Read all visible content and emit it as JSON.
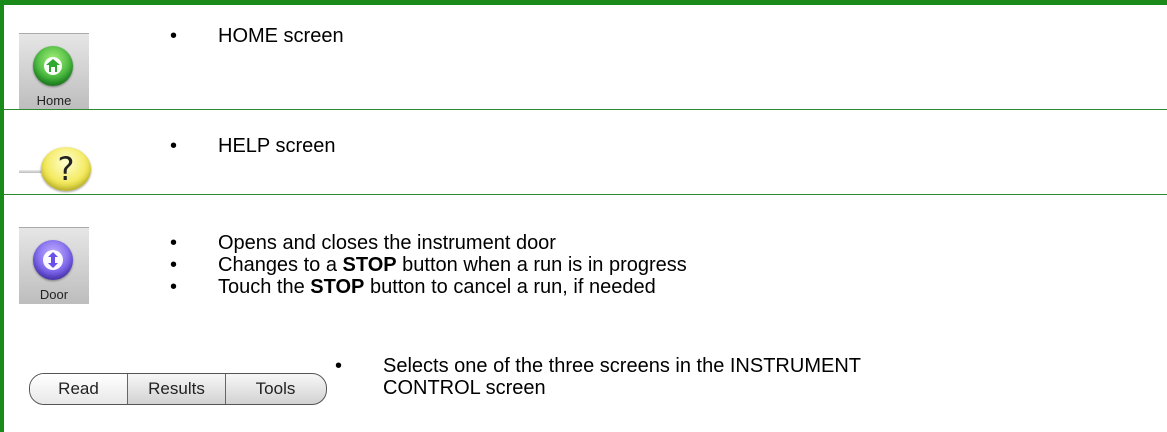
{
  "rows": [
    {
      "icon": {
        "name": "home",
        "label": "Home"
      },
      "bullets": [
        "HOME screen"
      ]
    },
    {
      "icon": {
        "name": "help",
        "glyph": "?"
      },
      "bullets": [
        "HELP screen"
      ]
    },
    {
      "icon": {
        "name": "door",
        "label": "Door"
      },
      "bullets": [
        "Opens and closes the instrument door",
        "Changes to a STOP button when a run is in progress",
        "Touch the STOP button to cancel a run, if needed"
      ],
      "bullets_parts": [
        {
          "pre": "Changes to a ",
          "bold": "STOP",
          "post": " button when a run is in progress"
        },
        {
          "pre": "Touch the ",
          "bold": "STOP",
          "post": " button to cancel a run, if needed"
        }
      ]
    },
    {
      "segmented": {
        "labels": [
          "Read",
          "Results",
          "Tools"
        ],
        "active_index": 0
      },
      "bullets": [
        "Selects one of the three screens in the INSTRUMENT CONTROL screen"
      ],
      "bullets_lines": [
        "Selects one of the three screens in the INSTRUMENT",
        "CONTROL screen"
      ]
    }
  ]
}
